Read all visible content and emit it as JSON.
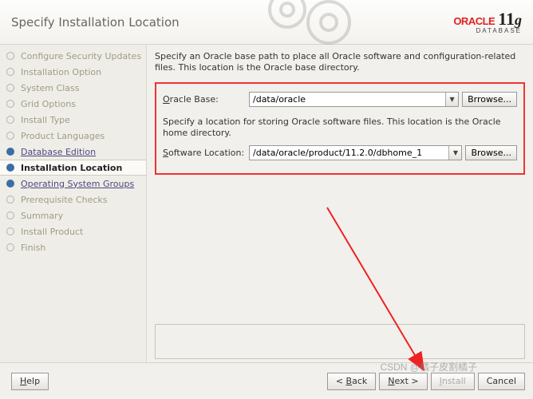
{
  "header": {
    "title": "Specify Installation Location",
    "brand_top": "ORACLE",
    "brand_num": "11",
    "brand_g": "g",
    "brand_sub": "DATABASE"
  },
  "sidebar": {
    "items": [
      {
        "label": "Configure Security Updates",
        "state": "done"
      },
      {
        "label": "Installation Option",
        "state": "done"
      },
      {
        "label": "System Class",
        "state": "done"
      },
      {
        "label": "Grid Options",
        "state": "done"
      },
      {
        "label": "Install Type",
        "state": "done"
      },
      {
        "label": "Product Languages",
        "state": "done"
      },
      {
        "label": "Database Edition",
        "state": "link"
      },
      {
        "label": "Installation Location",
        "state": "current"
      },
      {
        "label": "Operating System Groups",
        "state": "link"
      },
      {
        "label": "Prerequisite Checks",
        "state": "done"
      },
      {
        "label": "Summary",
        "state": "done"
      },
      {
        "label": "Install Product",
        "state": "done"
      },
      {
        "label": "Finish",
        "state": "done"
      }
    ]
  },
  "content": {
    "desc1": "Specify an Oracle base path to place all Oracle software and configuration-related files.  This location is the Oracle base directory.",
    "oracle_base_label": "racle Base:",
    "oracle_base_value": "/data/oracle",
    "desc2": "Specify a location for storing Oracle software files.  This location is the Oracle home directory.",
    "sw_loc_label": "oftware Location:",
    "sw_loc_value": "/data/oracle/product/11.2.0/dbhome_1",
    "browse": "rowse..."
  },
  "footer": {
    "help": "elp",
    "back": "ack",
    "next": "ext >",
    "install": "nstall",
    "cancel": "Cancel"
  },
  "watermark": "CSDN @橘子皮割橘子"
}
